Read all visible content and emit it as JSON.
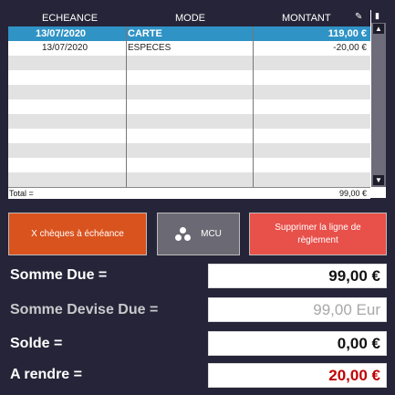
{
  "table": {
    "headers": [
      "ECHEANCE",
      "MODE",
      "MONTANT"
    ],
    "rows": [
      {
        "echeance": "13/07/2020",
        "mode": "CARTE",
        "montant": "119,00 €"
      },
      {
        "echeance": "13/07/2020",
        "mode": "ESPECES",
        "montant": "-20,00 €"
      }
    ],
    "total_label": "Total =",
    "total_value": "99,00 €"
  },
  "buttons": {
    "cheques": "X chèques à échéance",
    "mcu": "MCU",
    "supprimer": "Supprimer la ligne de règlement"
  },
  "summary": {
    "somme_due_label": "Somme Due =",
    "somme_due_value": "99,00 €",
    "somme_devise_label": "Somme Devise Due =",
    "somme_devise_value": "99,00 Eur",
    "solde_label": "Solde =",
    "solde_value": "0,00 €",
    "a_rendre_label": "A rendre =",
    "a_rendre_value": "20,00 €"
  },
  "colors": {
    "background": "#262438",
    "selected_row": "#2f93c5",
    "cheques_button": "#d9531e",
    "mcu_button": "#6b6a74",
    "supprimer_button": "#e8504a",
    "a_rendre_text": "#c00000"
  }
}
